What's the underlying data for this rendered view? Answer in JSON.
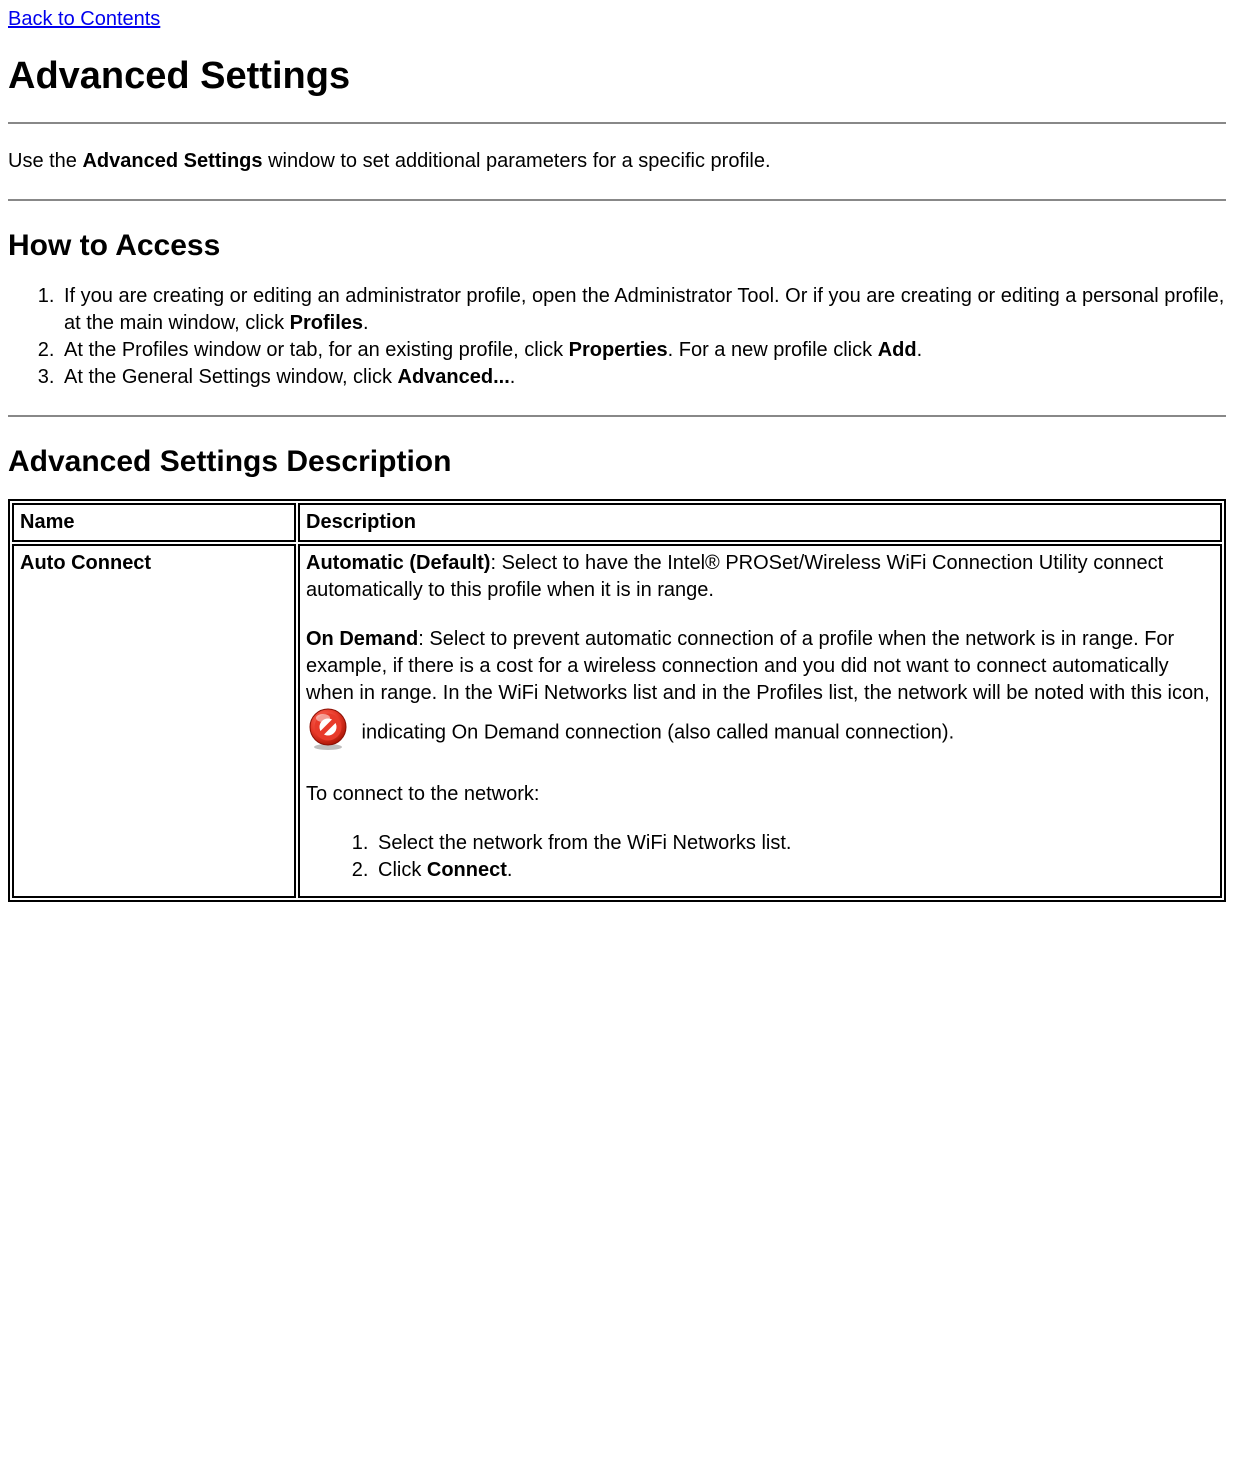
{
  "nav": {
    "back_link": "Back to Contents"
  },
  "headings": {
    "h1": "Advanced Settings",
    "h2_access": "How to Access",
    "h2_description": "Advanced Settings Description"
  },
  "intro": {
    "prefix": "Use the ",
    "bold": "Advanced Settings",
    "suffix": " window to set additional parameters for a specific profile."
  },
  "access_steps": {
    "s1_a": "If you are creating or editing an administrator profile, open the Administrator Tool. Or if you are creating or editing a personal profile, at the main window, click ",
    "s1_b": "Profiles",
    "s1_c": ".",
    "s2_a": "At the Profiles window or tab, for an existing profile, click ",
    "s2_b": "Properties",
    "s2_c": ". For a new profile click ",
    "s2_d": "Add",
    "s2_e": ".",
    "s3_a": "At the General Settings window, click ",
    "s3_b": "Advanced...",
    "s3_c": "."
  },
  "table": {
    "header_name": "Name",
    "header_desc": "Description",
    "row1_name": "Auto Connect",
    "auto_bold": "Automatic (Default)",
    "auto_text": ": Select to have the Intel® PROSet/Wireless WiFi Connection Utility connect automatically to this profile when it is in range.",
    "ondemand_bold": "On Demand",
    "ondemand_text": ": Select to prevent automatic connection of a profile when the network is in range. For example, if there is a cost for a wireless connection and you did not want to connect automatically when in range. In the WiFi Networks list and in the Profiles list, the network will be noted with this icon, ",
    "ondemand_after_icon": " indicating On Demand connection (also called manual connection).",
    "connect_intro": "To connect to the network:",
    "connect_step1": "Select the network from the WiFi Networks list.",
    "connect_step2_a": "Click ",
    "connect_step2_b": "Connect",
    "connect_step2_c": "."
  }
}
